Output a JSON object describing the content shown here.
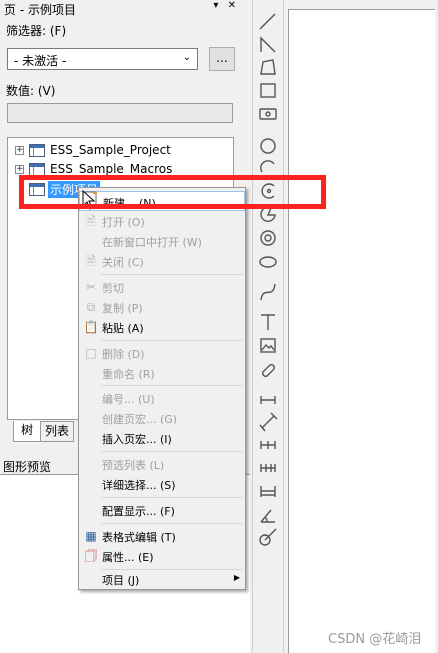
{
  "panel": {
    "title": "页 - 示例项目",
    "title_buttons": "▾ ✕",
    "filter_label": "筛选器: (F)",
    "filter_value": "- 未激活 -",
    "filter_more": "...",
    "value_label": "数值: (V)",
    "value_field": ""
  },
  "tree": {
    "nodes": [
      {
        "label": "ESS_Sample_Project"
      },
      {
        "label": "ESS_Sample_Macros"
      },
      {
        "label": "示例项目"
      }
    ]
  },
  "tabs": [
    {
      "label": "树"
    },
    {
      "label": "列表"
    }
  ],
  "preview": {
    "title": "图形预览"
  },
  "menu": {
    "items": [
      {
        "label": "新建... (N)",
        "icon": "new-page-icon",
        "enabled": true
      },
      {
        "label": "打开 (O)",
        "icon": "open-icon",
        "enabled": false
      },
      {
        "label": "在新窗口中打开 (W)",
        "icon": "",
        "enabled": false
      },
      {
        "label": "关闭 (C)",
        "icon": "close-page-icon",
        "enabled": false
      },
      {
        "label": "剪切",
        "icon": "scissors-icon",
        "enabled": false
      },
      {
        "label": "复制 (P)",
        "icon": "copy-icon",
        "enabled": false
      },
      {
        "label": "粘贴 (A)",
        "icon": "paste-icon",
        "enabled": true
      },
      {
        "label": "删除 (D)",
        "icon": "delete-icon",
        "enabled": false
      },
      {
        "label": "重命名 (R)",
        "icon": "",
        "enabled": false
      },
      {
        "label": "编号... (U)",
        "icon": "",
        "enabled": false
      },
      {
        "label": "创建页宏... (G)",
        "icon": "",
        "enabled": false
      },
      {
        "label": "插入页宏... (I)",
        "icon": "",
        "enabled": true
      },
      {
        "label": "预选列表 (L)",
        "icon": "",
        "enabled": false
      },
      {
        "label": "详细选择... (S)",
        "icon": "",
        "enabled": true
      },
      {
        "label": "配置显示... (F)",
        "icon": "",
        "enabled": true
      },
      {
        "label": "表格式编辑 (T)",
        "icon": "table-icon",
        "enabled": true
      },
      {
        "label": "属性... (E)",
        "icon": "properties-icon",
        "enabled": true
      },
      {
        "label": "项目 (J)",
        "icon": "",
        "enabled": true
      }
    ]
  },
  "watermark": "CSDN @花崎泪",
  "colors": {
    "highlight": "#ff2020",
    "selection": "#3399ff",
    "accent": "#3e6fb5"
  }
}
